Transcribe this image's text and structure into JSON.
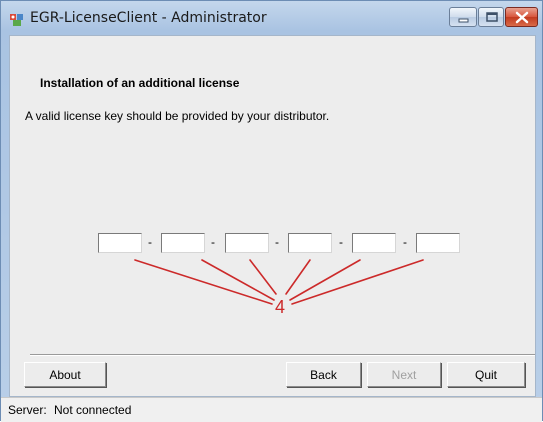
{
  "window": {
    "title": "EGR-LicenseClient - Administrator",
    "icons": {
      "app": "app-icon",
      "minimize": "minimize-icon",
      "maximize": "maximize-icon",
      "close": "close-icon"
    }
  },
  "panel": {
    "heading": "Installation of an additional license",
    "description": "A valid license key should be provided by your distributor."
  },
  "license_key": {
    "fields": [
      {
        "value": ""
      },
      {
        "value": ""
      },
      {
        "value": ""
      },
      {
        "value": ""
      },
      {
        "value": ""
      },
      {
        "value": ""
      }
    ],
    "separator": "-"
  },
  "annotation": {
    "label": "4",
    "color": "#cc2a2a"
  },
  "buttons": {
    "about": "About",
    "back": "Back",
    "next": "Next",
    "next_enabled": false,
    "quit": "Quit"
  },
  "status": {
    "label": "Server:",
    "value": "Not connected"
  }
}
